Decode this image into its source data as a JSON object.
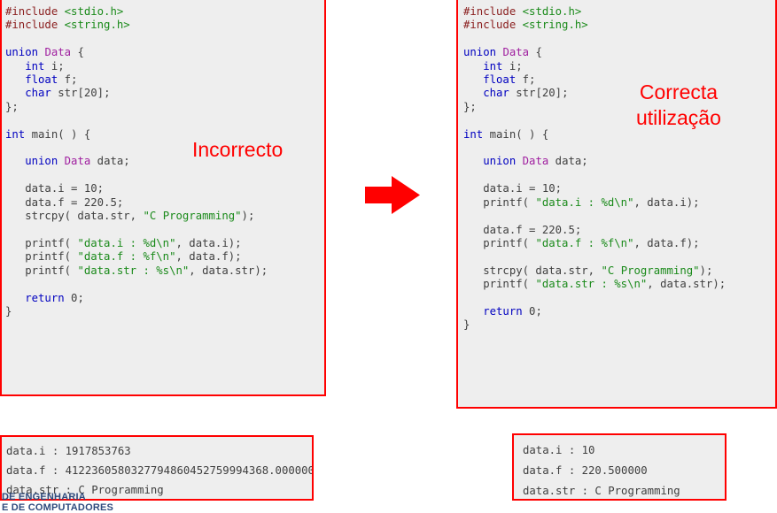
{
  "left_panel": {
    "title": "incorrect-union-usage",
    "caption": "Incorrecto",
    "code_lines": [
      [
        [
          "pre",
          "#include "
        ],
        [
          "str",
          "<stdio.h>"
        ]
      ],
      [
        [
          "pre",
          "#include "
        ],
        [
          "str",
          "<string.h>"
        ]
      ],
      [
        [
          "pun",
          ""
        ]
      ],
      [
        [
          "kw",
          "union"
        ],
        [
          "pun",
          " "
        ],
        [
          "typ",
          "Data"
        ],
        [
          "pun",
          " {"
        ]
      ],
      [
        [
          "pun",
          "   "
        ],
        [
          "kw",
          "int"
        ],
        [
          "pun",
          " i;"
        ]
      ],
      [
        [
          "pun",
          "   "
        ],
        [
          "kw",
          "float"
        ],
        [
          "pun",
          " f;"
        ]
      ],
      [
        [
          "pun",
          "   "
        ],
        [
          "kw",
          "char"
        ],
        [
          "pun",
          " str[20];"
        ]
      ],
      [
        [
          "pun",
          "};"
        ]
      ],
      [
        [
          "pun",
          ""
        ]
      ],
      [
        [
          "kw",
          "int"
        ],
        [
          "pun",
          " main( ) {"
        ]
      ],
      [
        [
          "pun",
          ""
        ]
      ],
      [
        [
          "pun",
          "   "
        ],
        [
          "kw",
          "union"
        ],
        [
          "pun",
          " "
        ],
        [
          "typ",
          "Data"
        ],
        [
          "pun",
          " data;"
        ]
      ],
      [
        [
          "pun",
          ""
        ]
      ],
      [
        [
          "pun",
          "   data.i = 10;"
        ]
      ],
      [
        [
          "pun",
          "   data.f = 220.5;"
        ]
      ],
      [
        [
          "pun",
          "   strcpy( data.str, "
        ],
        [
          "str",
          "\"C Programming\""
        ],
        [
          "pun",
          ");"
        ]
      ],
      [
        [
          "pun",
          ""
        ]
      ],
      [
        [
          "pun",
          "   printf( "
        ],
        [
          "str",
          "\"data.i : %d\\n\""
        ],
        [
          "pun",
          ", data.i);"
        ]
      ],
      [
        [
          "pun",
          "   printf( "
        ],
        [
          "str",
          "\"data.f : %f\\n\""
        ],
        [
          "pun",
          ", data.f);"
        ]
      ],
      [
        [
          "pun",
          "   printf( "
        ],
        [
          "str",
          "\"data.str : %s\\n\""
        ],
        [
          "pun",
          ", data.str);"
        ]
      ],
      [
        [
          "pun",
          ""
        ]
      ],
      [
        [
          "pun",
          "   "
        ],
        [
          "kw",
          "return"
        ],
        [
          "pun",
          " 0;"
        ]
      ],
      [
        [
          "pun",
          "}"
        ]
      ]
    ]
  },
  "right_panel": {
    "title": "correct-union-usage",
    "caption_line1": "Correcta",
    "caption_line2": "utilização",
    "code_lines": [
      [
        [
          "pre",
          "#include "
        ],
        [
          "str",
          "<stdio.h>"
        ]
      ],
      [
        [
          "pre",
          "#include "
        ],
        [
          "str",
          "<string.h>"
        ]
      ],
      [
        [
          "pun",
          ""
        ]
      ],
      [
        [
          "kw",
          "union"
        ],
        [
          "pun",
          " "
        ],
        [
          "typ",
          "Data"
        ],
        [
          "pun",
          " {"
        ]
      ],
      [
        [
          "pun",
          "   "
        ],
        [
          "kw",
          "int"
        ],
        [
          "pun",
          " i;"
        ]
      ],
      [
        [
          "pun",
          "   "
        ],
        [
          "kw",
          "float"
        ],
        [
          "pun",
          " f;"
        ]
      ],
      [
        [
          "pun",
          "   "
        ],
        [
          "kw",
          "char"
        ],
        [
          "pun",
          " str[20];"
        ]
      ],
      [
        [
          "pun",
          "};"
        ]
      ],
      [
        [
          "pun",
          ""
        ]
      ],
      [
        [
          "kw",
          "int"
        ],
        [
          "pun",
          " main( ) {"
        ]
      ],
      [
        [
          "pun",
          ""
        ]
      ],
      [
        [
          "pun",
          "   "
        ],
        [
          "kw",
          "union"
        ],
        [
          "pun",
          " "
        ],
        [
          "typ",
          "Data"
        ],
        [
          "pun",
          " data;"
        ]
      ],
      [
        [
          "pun",
          ""
        ]
      ],
      [
        [
          "pun",
          "   data.i = 10;"
        ]
      ],
      [
        [
          "pun",
          "   printf( "
        ],
        [
          "str",
          "\"data.i : %d\\n\""
        ],
        [
          "pun",
          ", data.i);"
        ]
      ],
      [
        [
          "pun",
          ""
        ]
      ],
      [
        [
          "pun",
          "   data.f = 220.5;"
        ]
      ],
      [
        [
          "pun",
          "   printf( "
        ],
        [
          "str",
          "\"data.f : %f\\n\""
        ],
        [
          "pun",
          ", data.f);"
        ]
      ],
      [
        [
          "pun",
          ""
        ]
      ],
      [
        [
          "pun",
          "   strcpy( data.str, "
        ],
        [
          "str",
          "\"C Programming\""
        ],
        [
          "pun",
          ");"
        ]
      ],
      [
        [
          "pun",
          "   printf( "
        ],
        [
          "str",
          "\"data.str : %s\\n\""
        ],
        [
          "pun",
          ", data.str);"
        ]
      ],
      [
        [
          "pun",
          ""
        ]
      ],
      [
        [
          "pun",
          "   "
        ],
        [
          "kw",
          "return"
        ],
        [
          "pun",
          " 0;"
        ]
      ],
      [
        [
          "pun",
          "}"
        ]
      ]
    ]
  },
  "left_output": {
    "lines": [
      "data.i : 1917853763",
      "data.f : 4122360580327794860452759994368.000000",
      "data.str : C Programming"
    ]
  },
  "right_output": {
    "lines": [
      "data.i : 10",
      "data.f : 220.500000",
      "data.str : C Programming"
    ]
  },
  "arrow": {
    "name": "red-right-arrow",
    "color": "#ff0000"
  },
  "footer": {
    "line1": "DE ENGENHARIA",
    "line2": "E DE COMPUTADORES"
  },
  "colors": {
    "accent_red": "#ff0000",
    "panel_background": "#eeeeee",
    "keyword": "#0000c0",
    "type": "#a020a0",
    "string": "#1a8a1a",
    "preprocessor": "#8b2020",
    "plain": "#3f3f3f"
  }
}
